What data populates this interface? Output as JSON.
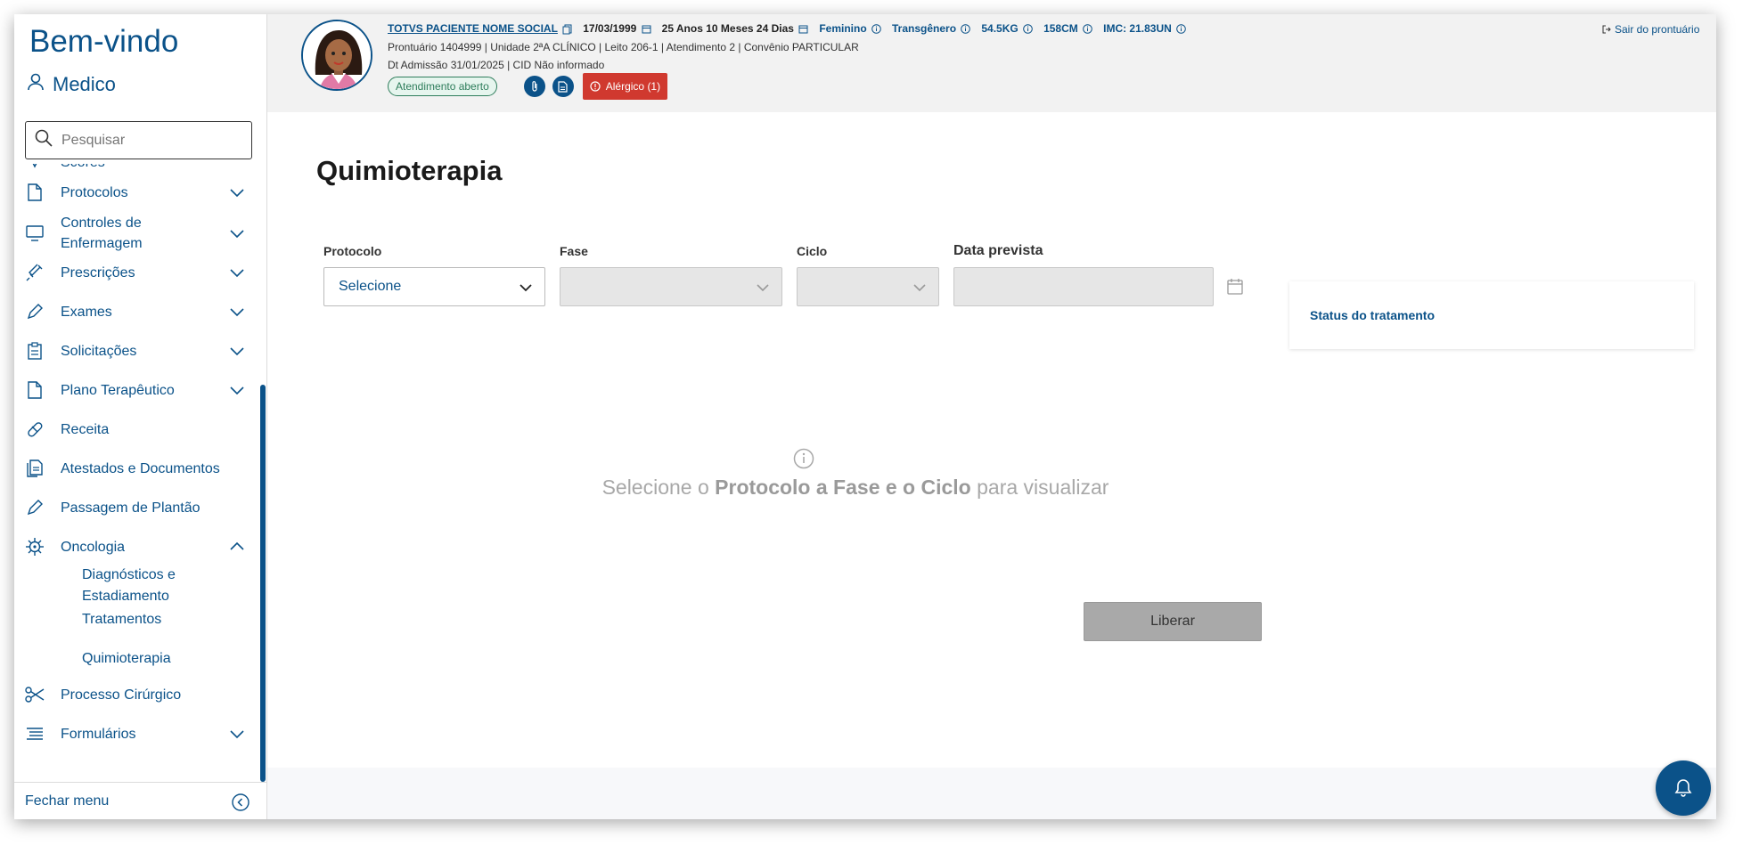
{
  "sidebar": {
    "welcome": "Bem-vindo",
    "role": "Medico",
    "search_placeholder": "Pesquisar",
    "items": [
      {
        "label": "Scores"
      },
      {
        "label": "Protocolos"
      },
      {
        "label": "Controles de Enfermagem"
      },
      {
        "label": "Prescrições"
      },
      {
        "label": "Exames"
      },
      {
        "label": "Solicitações"
      },
      {
        "label": "Plano Terapêutico"
      },
      {
        "label": "Receita"
      },
      {
        "label": "Atestados e Documentos"
      },
      {
        "label": "Passagem de Plantão"
      },
      {
        "label": "Oncologia"
      },
      {
        "label": "Processo Cirúrgico"
      },
      {
        "label": "Formulários"
      }
    ],
    "oncology_sub": [
      "Diagnósticos e Estadiamento",
      "Tratamentos",
      "Quimioterapia"
    ],
    "close_menu": "Fechar menu"
  },
  "header": {
    "patient_name": "TOTVS PACIENTE NOME SOCIAL",
    "birth_date": "17/03/1999",
    "age": "25 Anos 10 Meses 24 Dias",
    "sex": "Feminino",
    "gender": "Transgênero",
    "weight": "54.5KG",
    "height": "158CM",
    "bmi": "IMC: 21.83UN",
    "line2": "Prontuário 1404999  |  Unidade 2ªA CLÍNICO  |  Leito 206-1  |  Atendimento 2  |  Convênio PARTICULAR",
    "line3": "Dt Admissão 31/01/2025  |  CID Não informado",
    "status_badge": "Atendimento aberto",
    "allergy": "Alérgico (1)",
    "logout": "Sair do prontuário"
  },
  "main": {
    "title": "Quimioterapia",
    "protocol_label": "Protocolo",
    "protocol_value": "Selecione",
    "phase_label": "Fase",
    "cycle_label": "Ciclo",
    "date_label": "Data prevista",
    "status_label": "Status do tratamento",
    "empty_1": "Selecione o",
    "empty_2": "Protocolo a Fase e o Ciclo",
    "empty_3": "para visualizar",
    "release_button": "Liberar"
  },
  "colors": {
    "primary": "#0b5289",
    "allergy": "#d0392f",
    "open_badge": "#2e7d5b"
  }
}
